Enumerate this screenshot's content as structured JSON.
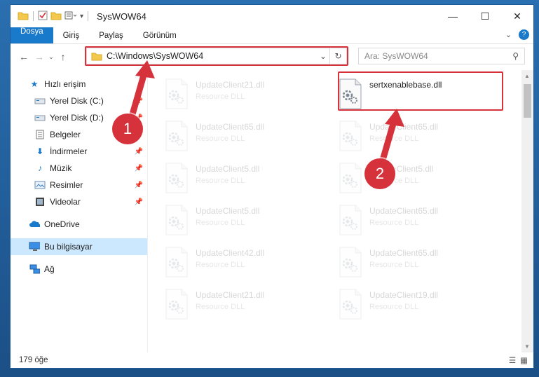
{
  "window": {
    "title": "SysWOW64",
    "controls": {
      "minimize": "—",
      "maximize": "☐",
      "close": "✕"
    }
  },
  "ribbon": {
    "tabs": [
      "Dosya",
      "Giriş",
      "Paylaş",
      "Görünüm"
    ],
    "help_icon": "?"
  },
  "address": {
    "path": "C:\\Windows\\SysWOW64",
    "search_placeholder": "Ara: SysWOW64"
  },
  "sidebar": {
    "quick_access": "Hızlı erişim",
    "quick_items": [
      {
        "label": "Yerel Disk (C:)",
        "icon": "drive-icon"
      },
      {
        "label": "Yerel Disk (D:)",
        "icon": "drive-icon"
      },
      {
        "label": "Belgeler",
        "icon": "documents-icon"
      },
      {
        "label": "İndirmeler",
        "icon": "download-icon"
      },
      {
        "label": "Müzik",
        "icon": "music-icon"
      },
      {
        "label": "Resimler",
        "icon": "pictures-icon"
      },
      {
        "label": "Videolar",
        "icon": "videos-icon"
      }
    ],
    "onedrive": "OneDrive",
    "this_pc": "Bu bilgisayar",
    "network": "Ağ"
  },
  "files": [
    {
      "name": "UpdateClient21.dll",
      "type": "Resource DLL",
      "faded": true
    },
    {
      "name": "sertxenablebase.dll",
      "type": "",
      "faded": false
    },
    {
      "name": "UpdateClient65.dll",
      "type": "Resource DLL",
      "faded": true
    },
    {
      "name": "UpdateClient65.dll",
      "type": "Resource DLL",
      "faded": true
    },
    {
      "name": "UpdateClient5.dll",
      "type": "Resource DLL",
      "faded": true
    },
    {
      "name": "UpdateClient5.dll",
      "type": "Resource DLL",
      "faded": true
    },
    {
      "name": "UpdateClient5.dll",
      "type": "Resource DLL",
      "faded": true
    },
    {
      "name": "UpdateClient65.dll",
      "type": "Resource DLL",
      "faded": true
    },
    {
      "name": "UpdateClient42.dll",
      "type": "Resource DLL",
      "faded": true
    },
    {
      "name": "UpdateClient65.dll",
      "type": "Resource DLL",
      "faded": true
    },
    {
      "name": "UpdateClient21.dll",
      "type": "Resource DLL",
      "faded": true
    },
    {
      "name": "UpdateClient19.dll",
      "type": "Resource DLL",
      "faded": true
    }
  ],
  "status": {
    "count": "179 öğe"
  },
  "callouts": {
    "one": "1",
    "two": "2"
  },
  "colors": {
    "accent": "#1979ca",
    "highlight": "#d6323c",
    "selected": "#cce8ff"
  }
}
